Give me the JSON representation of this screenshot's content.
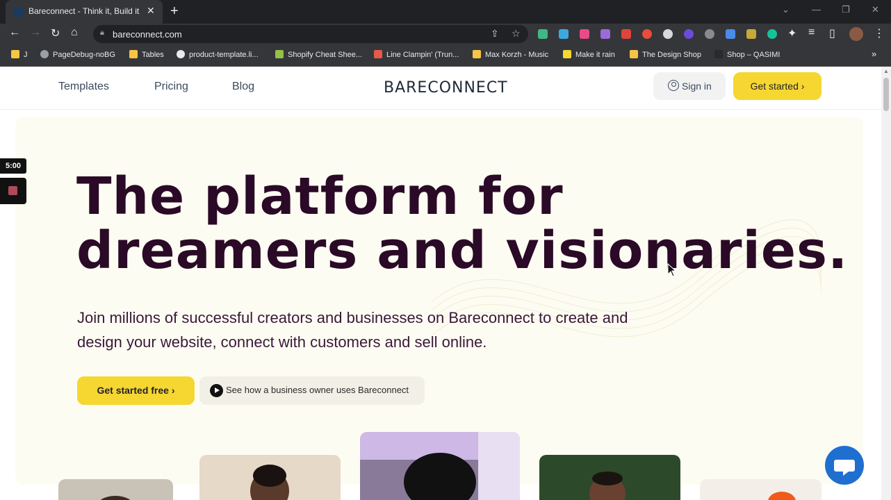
{
  "browser": {
    "tab_title": "Bareconnect - Think it, Build it",
    "tab_close": "✕",
    "new_tab": "+",
    "url": "bareconnect.com",
    "bookmarks": [
      {
        "label": "J",
        "color": "#f6c544"
      },
      {
        "label": "PageDebug-noBG",
        "color": "#9aa0a6"
      },
      {
        "label": "Tables",
        "color": "#f6c544"
      },
      {
        "label": "product-template.li...",
        "color": "#e8eaed"
      },
      {
        "label": "Shopify Cheat Shee...",
        "color": "#95bf47"
      },
      {
        "label": "Line Clampin' (Trun...",
        "color": "#e8594a"
      },
      {
        "label": "Max Korzh - Music",
        "color": "#f6c544"
      },
      {
        "label": "Make it rain",
        "color": "#f6d631"
      },
      {
        "label": "The Design Shop",
        "color": "#f6c544"
      },
      {
        "label": "Shop – QASIMI",
        "color": "#2a2a2a"
      }
    ],
    "bookmarks_more": "»"
  },
  "site": {
    "nav": {
      "templates": "Templates",
      "pricing": "Pricing",
      "blog": "Blog",
      "logo": "BARECONNECT",
      "signin": "Sign in",
      "get_started": "Get started ›"
    },
    "hero": {
      "title_line1": "The platform for",
      "title_line2": "dreamers and visionaries.",
      "subtitle": "Join millions of successful creators and businesses on Bareconnect to create and design your website, connect with customers and sell online.",
      "cta_primary": "Get started free ›",
      "cta_secondary": "See how a business owner uses Bareconnect"
    },
    "accent_color": "#f6d631",
    "title_color": "#2a0a26"
  },
  "overlay": {
    "timer": "5:00"
  }
}
